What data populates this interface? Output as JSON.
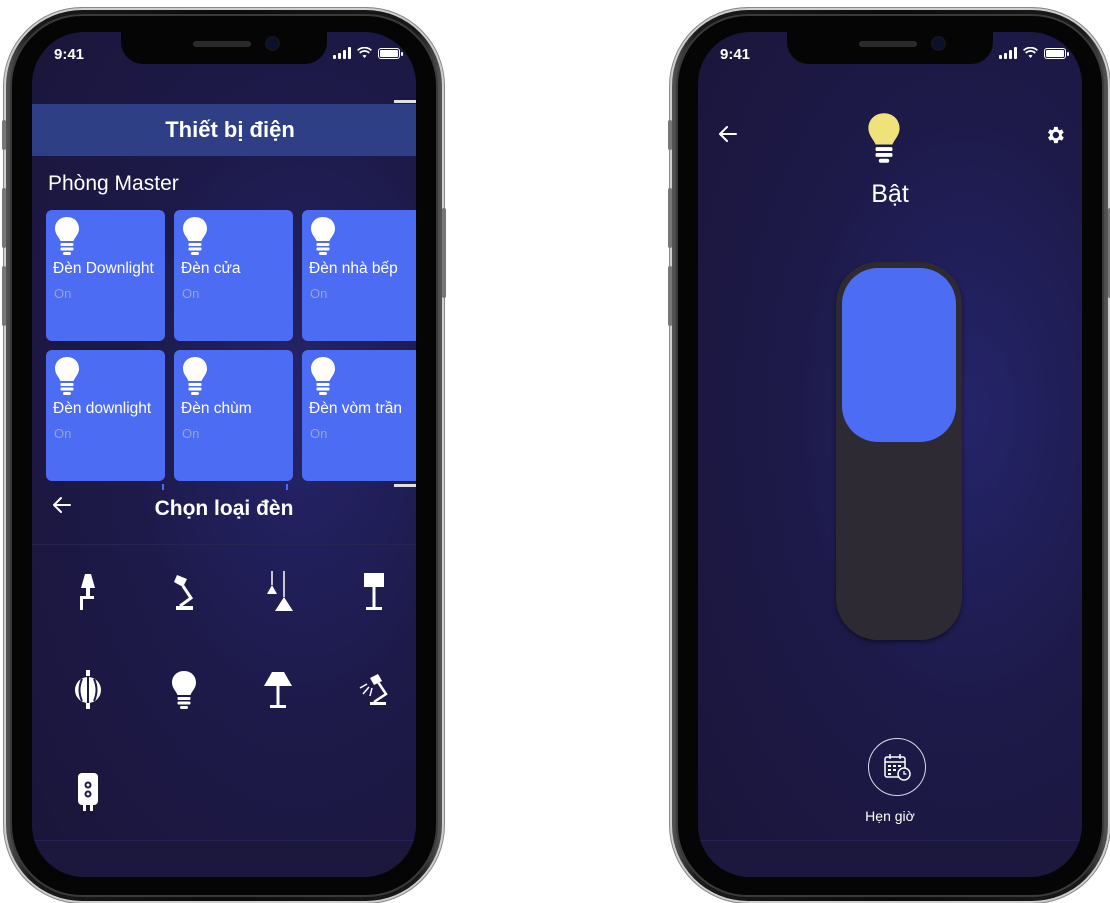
{
  "left_phone": {
    "status": {
      "time": "9:41"
    },
    "appbar": {
      "title": "Thiết bị điện"
    },
    "room": {
      "title": "Phòng Master",
      "devices": [
        {
          "name": "Đèn Downlight",
          "state": "On"
        },
        {
          "name": "Đèn cửa",
          "state": "On"
        },
        {
          "name": "Đèn nhà bếp",
          "state": "On"
        },
        {
          "name": "Đèn downlight",
          "state": "On"
        },
        {
          "name": "Đèn chùm",
          "state": "On"
        },
        {
          "name": "Đèn vòm trần",
          "state": "On"
        }
      ]
    },
    "picker": {
      "back_icon": "arrow-left-icon",
      "title": "Chọn loại đèn",
      "lamp_types": [
        "wall-lamp-icon",
        "desk-lamp-icon",
        "pendant-lamp-icon",
        "floor-lamp-icon",
        "lantern-icon",
        "bulb-icon",
        "table-lamp-icon",
        "spot-lamp-icon",
        "socket-icon"
      ]
    }
  },
  "right_phone": {
    "status": {
      "time": "9:41"
    },
    "back_icon": "arrow-left-icon",
    "settings_icon": "gear-icon",
    "bulb_color": "#f0e27a",
    "state_label": "Bật",
    "switch": {
      "on": true,
      "accent": "#4d6cf4"
    },
    "timer": {
      "icon": "calendar-clock-icon",
      "label": "Hẹn giờ"
    }
  }
}
